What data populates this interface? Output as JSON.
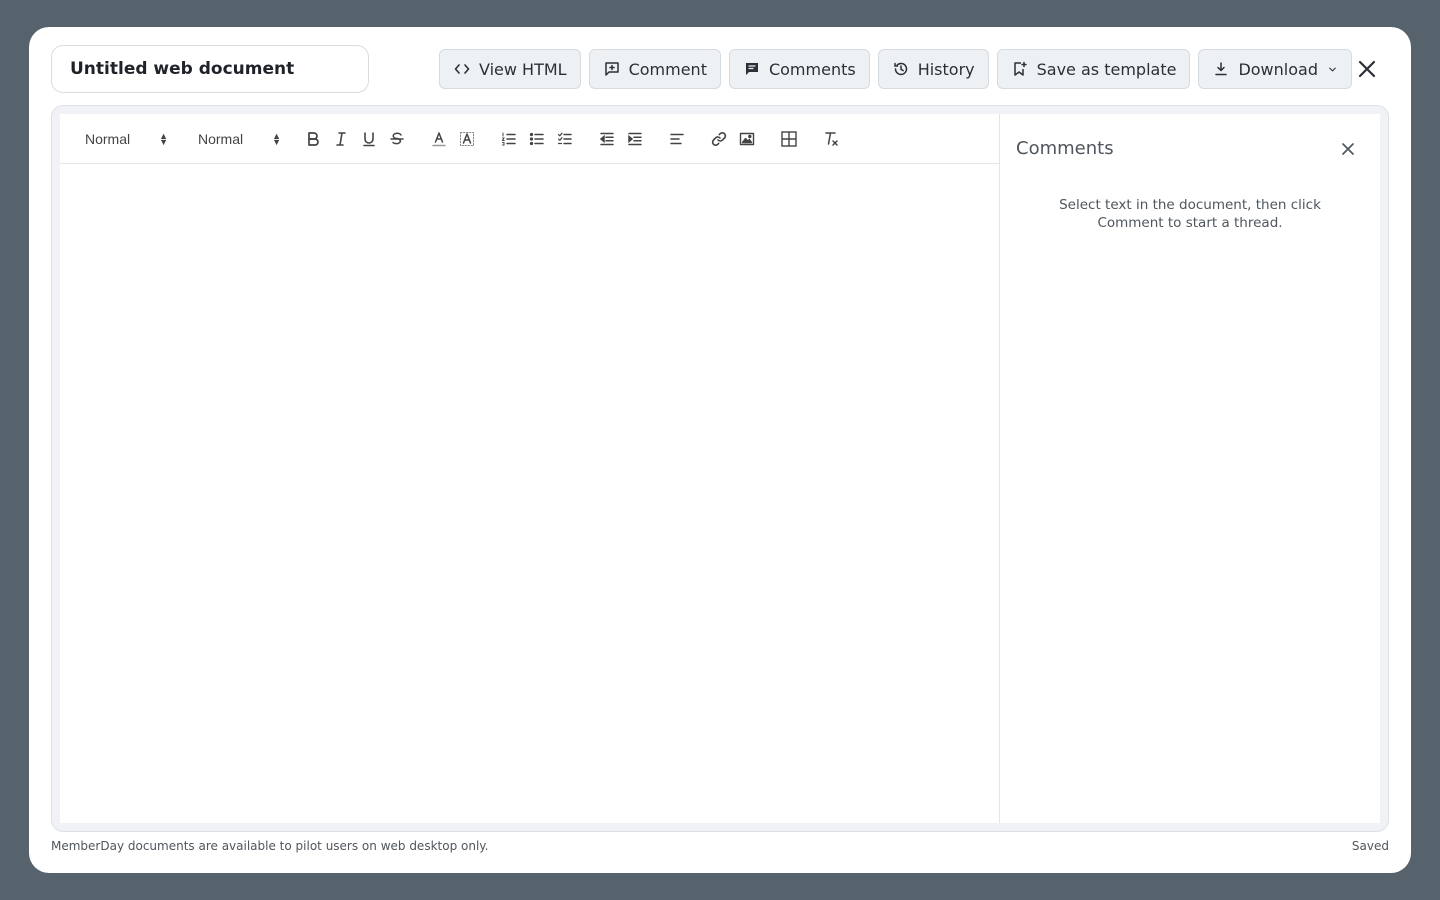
{
  "document": {
    "title": "Untitled web document"
  },
  "actions": {
    "view_html": "View HTML",
    "comment": "Comment",
    "comments": "Comments",
    "history": "History",
    "save_template": "Save as template",
    "download": "Download"
  },
  "toolbar": {
    "heading_select": "Normal",
    "size_select": "Normal",
    "icons": [
      "bold-icon",
      "italic-icon",
      "underline-icon",
      "strikethrough-icon",
      "text-color-icon",
      "background-color-icon",
      "ordered-list-icon",
      "bullet-list-icon",
      "checklist-icon",
      "outdent-icon",
      "indent-icon",
      "align-left-icon",
      "link-icon",
      "image-icon",
      "table-icon",
      "clear-format-icon"
    ]
  },
  "comments_panel": {
    "title": "Comments",
    "empty_message": "Select text in the document, then click Comment to start a thread."
  },
  "footer": {
    "note": "MemberDay documents are available to pilot users on web desktop only.",
    "status": "Saved"
  },
  "colors": {
    "backdrop": "#57636c",
    "button_bg": "#eef1f4",
    "text": "#2b3036",
    "muted": "#4f565d"
  }
}
